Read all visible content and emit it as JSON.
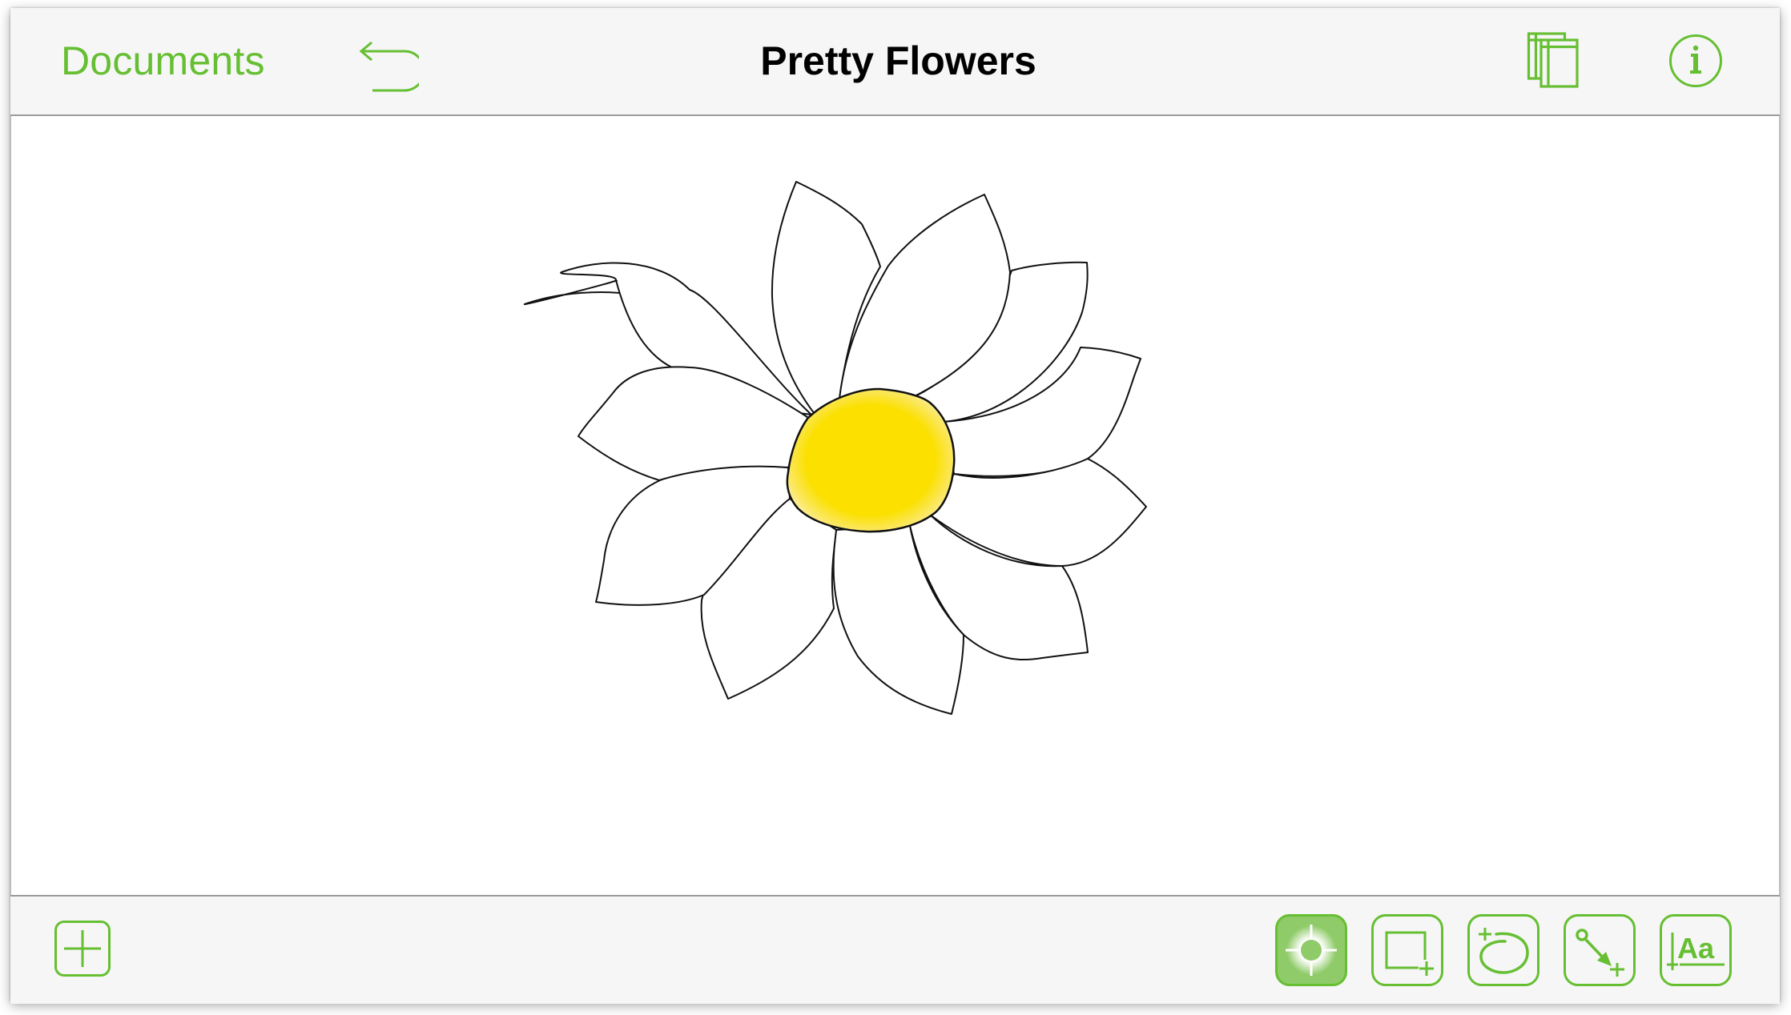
{
  "app": {
    "accent_color": "#66BF33",
    "document_title": "Pretty Flowers"
  },
  "header": {
    "documents_label": "Documents",
    "undo_icon": "undo-arrow-icon",
    "pages_icon": "canvases-icon",
    "info_icon": "info-icon",
    "info_glyph": "i"
  },
  "canvas": {
    "drawing": "daisy flower",
    "petal_count": 12,
    "petal_fill": "#FFFFFF",
    "petal_stroke": "#000000",
    "center_fill": "#FBE000"
  },
  "bottom_toolbar": {
    "add_icon": "plus-icon",
    "tools": [
      {
        "name": "selection-tool",
        "icon": "crosshair-icon",
        "selected": true
      },
      {
        "name": "shape-tool",
        "icon": "rectangle-plus-icon",
        "selected": false
      },
      {
        "name": "freehand-tool",
        "icon": "lasso-plus-icon",
        "selected": false
      },
      {
        "name": "line-tool",
        "icon": "connector-arrow-icon",
        "selected": false
      },
      {
        "name": "text-tool",
        "icon": "text-plus-icon",
        "selected": false,
        "label": "Aa"
      }
    ]
  }
}
